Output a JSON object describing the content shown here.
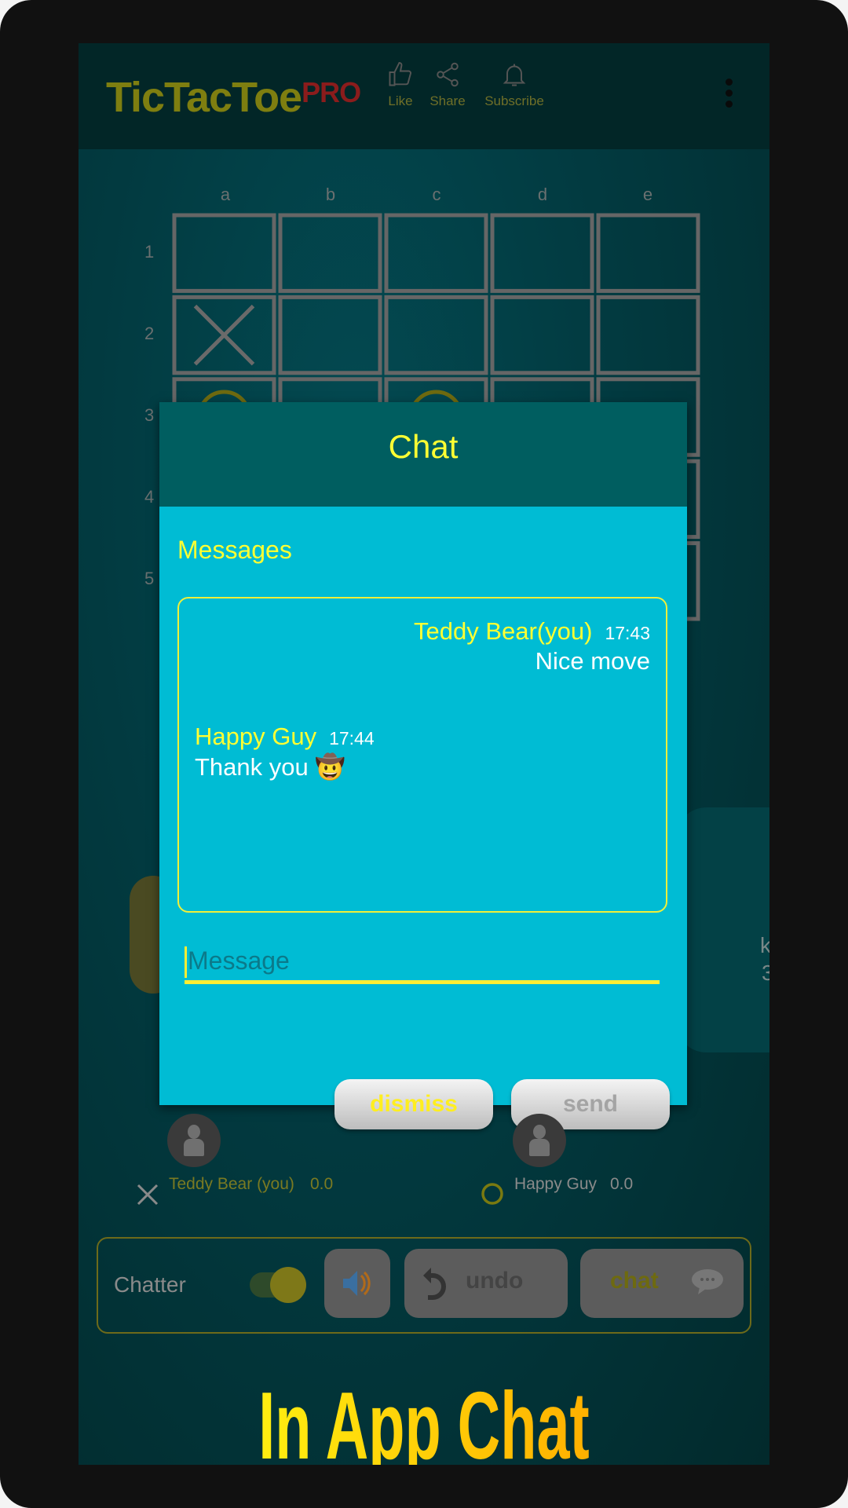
{
  "header": {
    "title": "TicTacToe",
    "title_suffix": "PRO",
    "actions": [
      {
        "label": "Like",
        "icon": "thumbs-up-icon"
      },
      {
        "label": "Share",
        "icon": "share-icon"
      },
      {
        "label": "Subscribe",
        "icon": "bell-icon"
      }
    ],
    "menu_icon": "more-vert-icon"
  },
  "board": {
    "columns": [
      "a",
      "b",
      "c",
      "d",
      "e"
    ],
    "rows": [
      "1",
      "2",
      "3",
      "4",
      "5"
    ],
    "pieces": [
      {
        "cell": "a2",
        "mark": "X"
      },
      {
        "cell": "a3",
        "mark": "O"
      },
      {
        "cell": "c3",
        "mark": "O"
      }
    ]
  },
  "side_panel": {
    "text_line1": "kes",
    "text_line2": "3"
  },
  "chat_dialog": {
    "title": "Chat",
    "messages_label": "Messages",
    "messages": [
      {
        "sender": "Teddy Bear(you)",
        "time": "17:43",
        "text": "Nice move",
        "align": "right"
      },
      {
        "sender": "Happy Guy",
        "time": "17:44",
        "text": "Thank you",
        "emoji": "🤠",
        "align": "left"
      }
    ],
    "input": {
      "value": "",
      "placeholder": "Message"
    },
    "dismiss_label": "dismiss",
    "send_label": "send"
  },
  "players": [
    {
      "name": "Teddy Bear (you)",
      "score": "0.0",
      "mark": "X"
    },
    {
      "name": "Happy Guy",
      "score": "0.0",
      "mark": "O"
    }
  ],
  "bottom_bar": {
    "chatter_label": "Chatter",
    "chatter_on": true,
    "sound_icon": "speaker-icon",
    "undo_label": "undo",
    "chat_label": "chat"
  },
  "banner": "In App Chat",
  "colors": {
    "accent_yellow": "#ffff33",
    "dialog_bg": "#00bcd4",
    "dialog_header": "#005e60",
    "brand_red": "#8b1c1c"
  }
}
